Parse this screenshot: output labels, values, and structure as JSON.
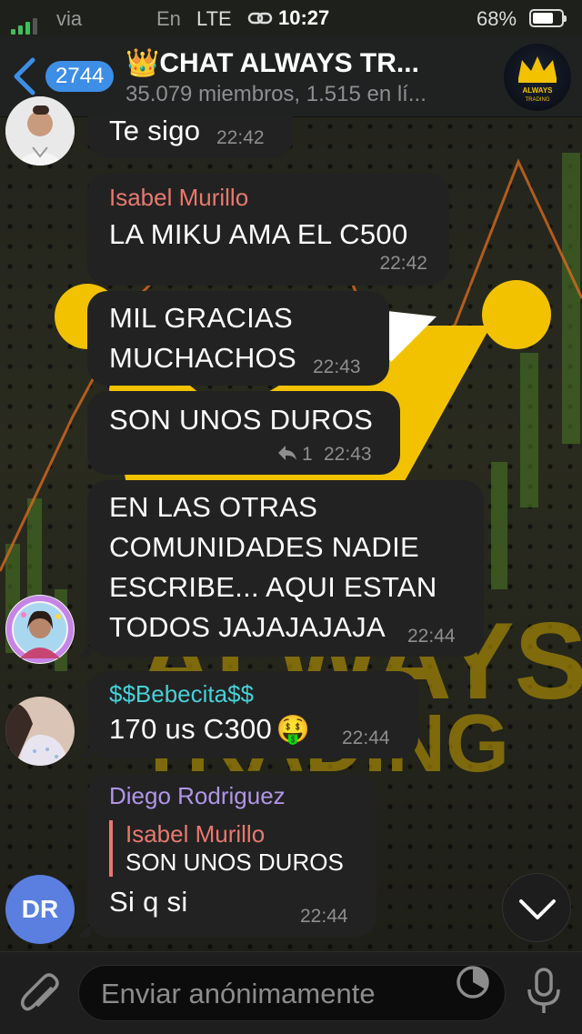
{
  "status_bar": {
    "carrier": "via",
    "language": "En",
    "network": "LTE",
    "time": "10:27",
    "battery": "68%",
    "battery_level": 0.68
  },
  "header": {
    "unread_count": "2744",
    "title": "👑CHAT ALWAYS TR...",
    "subtitle": "35.079 miembros, 1.515 en lí...",
    "avatar_text_1": "ALWAYS",
    "avatar_text_2": "TRADING"
  },
  "messages": [
    {
      "text": "Te sigo",
      "time": "22:42"
    },
    {
      "sender": "Isabel Murillo",
      "sender_color": "#e8796f",
      "text": "LA MIKU AMA EL C500",
      "time": "22:42"
    },
    {
      "text_lines": [
        "MIL GRACIAS",
        "MUCHACHOS"
      ],
      "time": "22:43"
    },
    {
      "text": "SON UNOS DUROS",
      "reply_count": "1",
      "time": "22:43"
    },
    {
      "text_lines": [
        "EN LAS OTRAS",
        "COMUNIDADES NADIE",
        "ESCRIBE... AQUI ESTAN",
        "TODOS JAJAJAJAJA"
      ],
      "time": "22:44"
    },
    {
      "sender": "$$Bebecita$$",
      "sender_color": "#45d1d8",
      "text": "170 us C300",
      "emoji": "🤑",
      "time": "22:44"
    },
    {
      "sender": "Diego Rodriguez",
      "sender_color": "#b195e8",
      "quote_author": "Isabel Murillo",
      "quote_author_color": "#e8796f",
      "quote_text": "SON UNOS DUROS",
      "text": "Si q si",
      "time": "22:44",
      "avatar_initials": "DR"
    }
  ],
  "input": {
    "placeholder": "Enviar anónimamente"
  },
  "colors": {
    "accent": "#3d8ee6",
    "bubble": "#222222",
    "wallpaper_yellow": "#f2c200"
  }
}
